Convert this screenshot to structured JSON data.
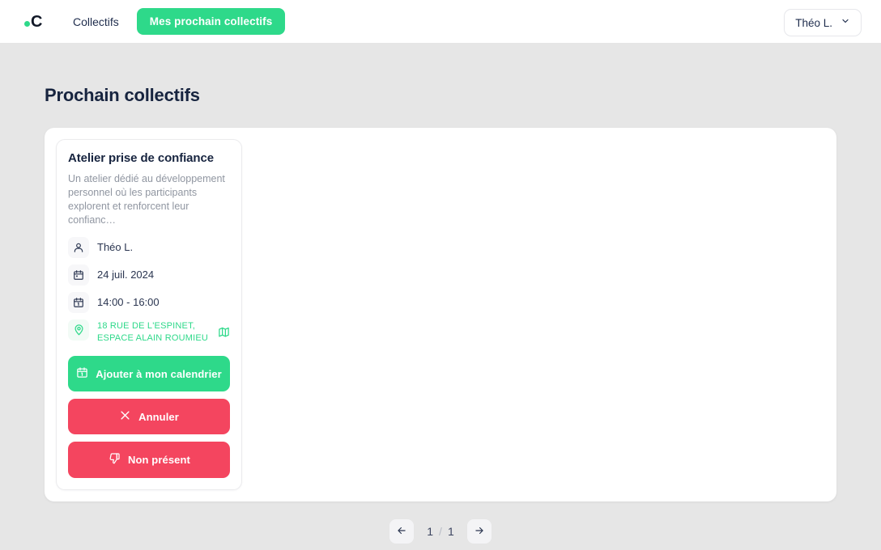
{
  "header": {
    "logo_letter": "C",
    "logo_dot_color": "#2ed98a",
    "nav_link_label": "Collectifs",
    "nav_pill_label": "Mes prochain collectifs",
    "user_menu_label": "Théo L."
  },
  "page": {
    "title": "Prochain collectifs"
  },
  "event": {
    "title": "Atelier prise de confiance",
    "description": "Un atelier dédié au développement personnel où les participants explorent et renforcent leur confianc…",
    "organizer": "Théo L.",
    "date": "24 juil. 2024",
    "time": "14:00 - 16:00",
    "address": "18 RUE DE L'ESPINET, ESPACE ALAIN ROUMIEU",
    "buttons": {
      "calendar": "Ajouter à mon calendrier",
      "cancel": "Annuler",
      "absent": "Non présent"
    }
  },
  "pagination": {
    "prev_icon": "arrow-left-icon",
    "next_icon": "arrow-right-icon",
    "current_page": "1",
    "separator": "/",
    "total_pages": "1"
  },
  "colors": {
    "accent_green": "#2ed98a",
    "danger_red": "#f4455f",
    "page_background": "#e6e6e6",
    "text_dark": "#17243f",
    "text_muted": "#9096a1"
  }
}
